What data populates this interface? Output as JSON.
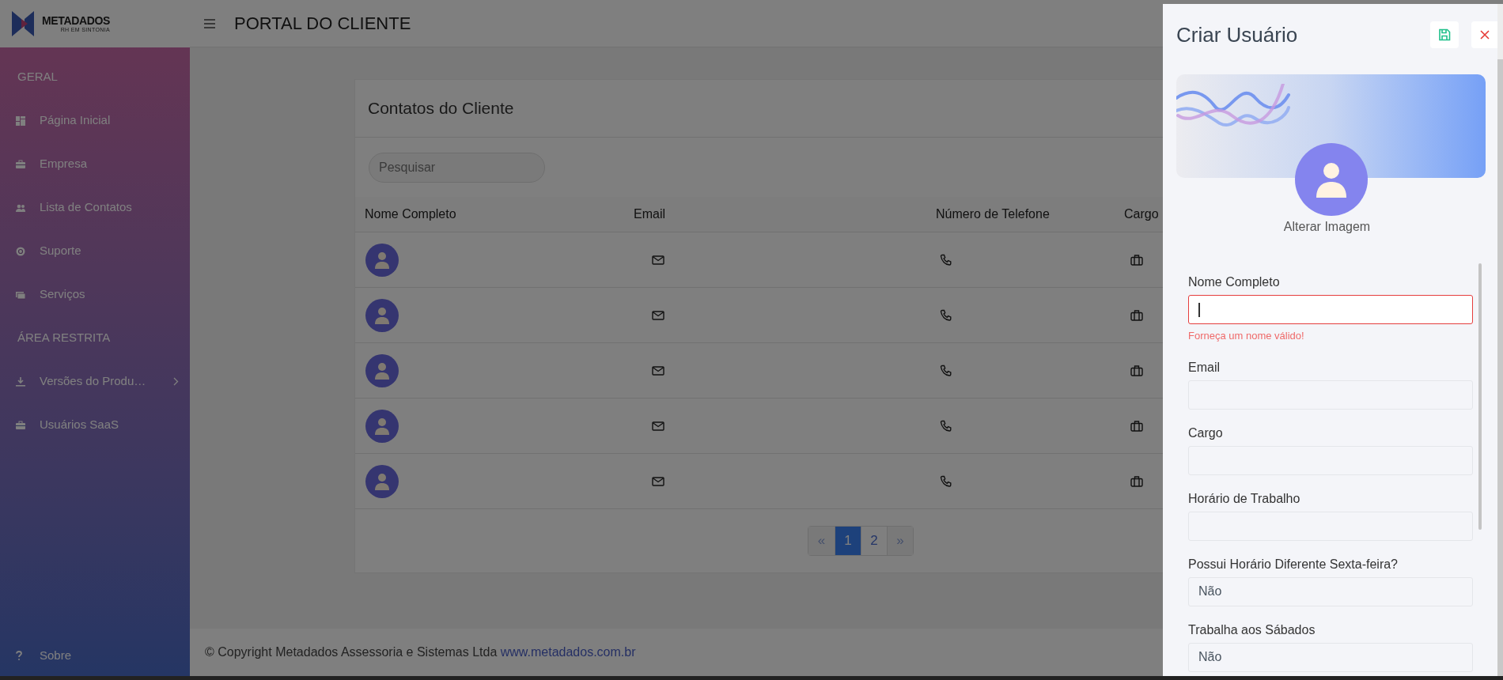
{
  "logo": {
    "name": "METADADOS",
    "tagline": "RH EM SINTONIA"
  },
  "header": {
    "title": "PORTAL DO CLIENTE"
  },
  "sidebar": {
    "sections": [
      {
        "title": "GERAL",
        "items": [
          {
            "label": "Página Inicial",
            "expandable": false
          },
          {
            "label": "Empresa",
            "expandable": false
          },
          {
            "label": "Lista de Contatos",
            "expandable": false
          },
          {
            "label": "Suporte",
            "expandable": false
          },
          {
            "label": "Serviços",
            "expandable": false
          }
        ]
      },
      {
        "title": "ÁREA RESTRITA",
        "items": [
          {
            "label": "Versões do Produ…",
            "expandable": true
          },
          {
            "label": "Usuários SaaS",
            "expandable": false
          }
        ]
      }
    ],
    "bottom_item": {
      "label": "Sobre"
    }
  },
  "card": {
    "title": "Contatos do Cliente",
    "search": {
      "placeholder": "Pesquisar"
    },
    "table": {
      "columns": [
        "Nome Completo",
        "Email",
        "Número de Telefone",
        "Cargo"
      ],
      "rows": [
        {
          "kind": "contact"
        },
        {
          "kind": "contact"
        },
        {
          "kind": "contact"
        },
        {
          "kind": "contact"
        },
        {
          "kind": "contact"
        }
      ]
    },
    "pagination": [
      {
        "label": "«",
        "kind": "prev",
        "selected": false
      },
      {
        "label": "1",
        "kind": "page",
        "selected": true
      },
      {
        "label": "2",
        "kind": "page",
        "selected": false
      },
      {
        "label": "»",
        "kind": "next",
        "selected": false
      }
    ]
  },
  "footer": {
    "text": "© Copyright Metadados Assessoria e Sistemas Ltda",
    "link": "www.metadados.com.br"
  },
  "drawer": {
    "title": "Criar Usuário",
    "change_image": "Alterar Imagem",
    "fields": [
      {
        "label": "Nome Completo",
        "focused": true,
        "invalid": true,
        "error": "Forneça um nome válido!"
      },
      {
        "label": "Email",
        "focused": false,
        "invalid": false
      },
      {
        "label": "Cargo",
        "focused": false,
        "invalid": false
      },
      {
        "label": "Horário de Trabalho",
        "focused": false,
        "invalid": false
      },
      {
        "label": "Possui Horário Diferente Sexta-feira?",
        "value": "Não",
        "focused": false,
        "invalid": false
      },
      {
        "label": "Trabalha aos Sábados",
        "value": "Não",
        "focused": false,
        "invalid": false
      }
    ]
  }
}
